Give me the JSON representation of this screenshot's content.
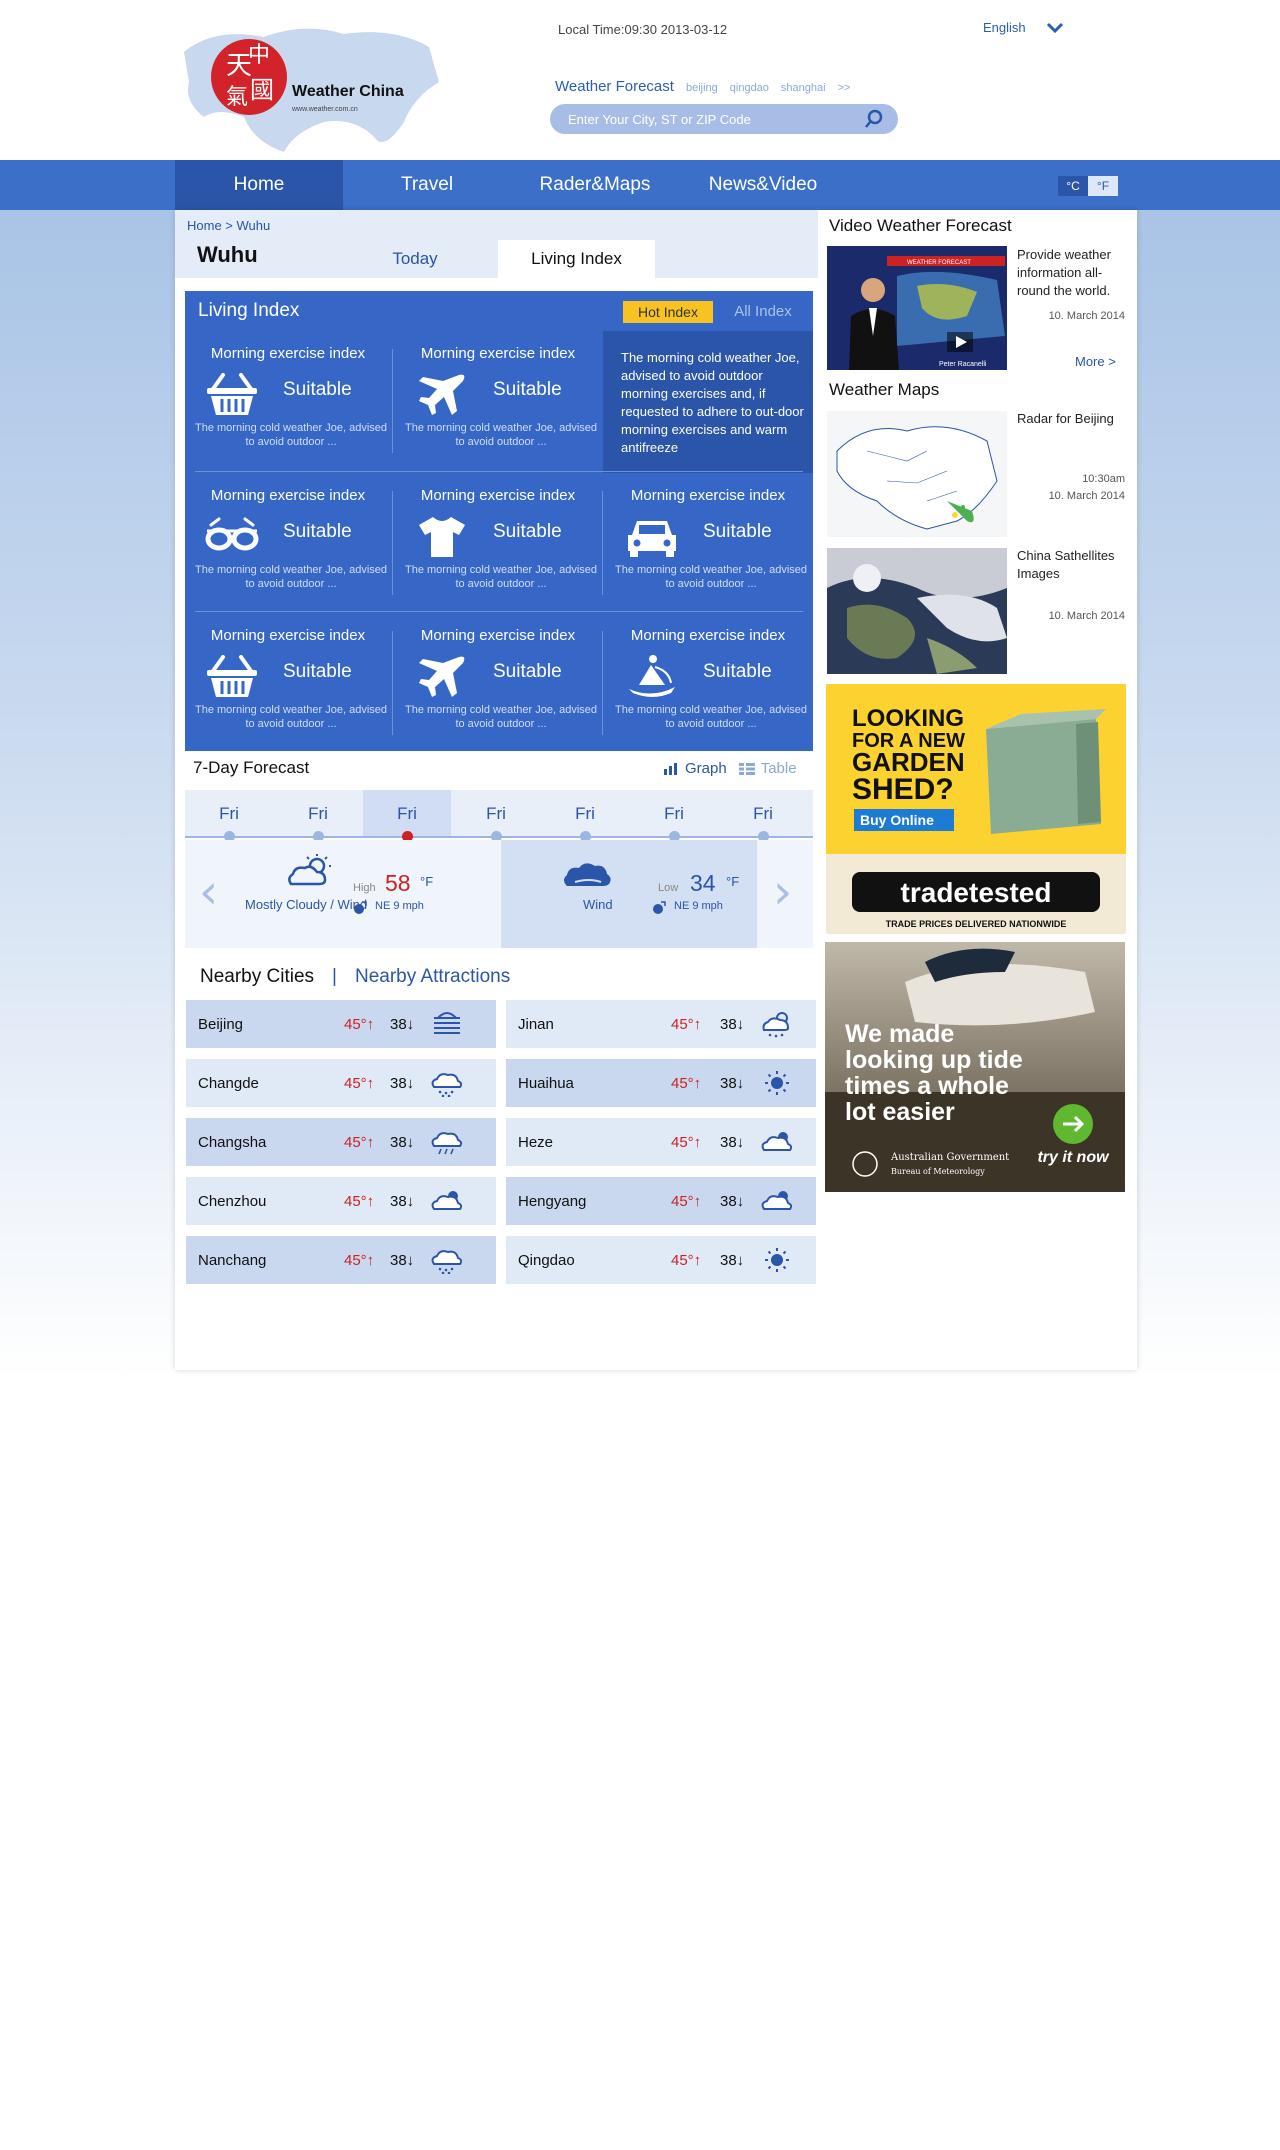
{
  "header": {
    "logo_text": "Weather China",
    "logo_url_text": "www.weather.com.cn",
    "local_time": "Local Time:09:30  2013-03-12",
    "language": "English",
    "forecast_label": "Weather Forecast",
    "quick_cities": [
      "beijing",
      "qingdao",
      "shanghai",
      ">>"
    ],
    "search_placeholder": "Enter Your City, ST or ZIP Code"
  },
  "nav": {
    "items": [
      "Home",
      "Travel",
      "Rader&Maps",
      "News&Video"
    ],
    "active": "Home",
    "unit_c": "°C",
    "unit_f": "°F"
  },
  "location": {
    "breadcrumb": "Home > Wuhu",
    "city": "Wuhu",
    "tabs": [
      "Today",
      "Living Index"
    ],
    "active_tab": "Living Index"
  },
  "living_index": {
    "title": "Living Index",
    "hot_label": "Hot Index",
    "all_label": "All Index",
    "feature_text": "The morning cold weather Joe, advised to avoid outdoor morning exercises and, if requested to adhere to out-door morning exercises and warm antifreeze",
    "items": [
      {
        "title": "Morning exercise index",
        "status": "Suitable",
        "desc": "The morning cold weather Joe, advised to avoid outdoor ...",
        "icon": "basket-icon"
      },
      {
        "title": "Morning exercise index",
        "status": "Suitable",
        "desc": "The morning cold weather Joe, advised to avoid outdoor ...",
        "icon": "airplane-icon"
      },
      {
        "title": "Morning exercise index",
        "status": "Suitable",
        "desc": "The morning cold weather Joe, advised to avoid outdoor ...",
        "icon": "sunglasses-icon"
      },
      {
        "title": "Morning exercise index",
        "status": "Suitable",
        "desc": "The morning cold weather Joe, advised to avoid outdoor ...",
        "icon": "tshirt-icon"
      },
      {
        "title": "Morning exercise index",
        "status": "Suitable",
        "desc": "The morning cold weather Joe, advised to avoid outdoor ...",
        "icon": "car-icon"
      },
      {
        "title": "Morning exercise index",
        "status": "Suitable",
        "desc": "The morning cold weather Joe, advised to avoid outdoor ...",
        "icon": "basket-icon"
      },
      {
        "title": "Morning exercise index",
        "status": "Suitable",
        "desc": "The morning cold weather Joe, advised to avoid outdoor ...",
        "icon": "airplane-icon"
      },
      {
        "title": "Morning exercise index",
        "status": "Suitable",
        "desc": "The morning cold weather Joe, advised to avoid outdoor ...",
        "icon": "sailing-icon"
      }
    ]
  },
  "forecast": {
    "title": "7-Day Forecast",
    "graph_label": "Graph",
    "table_label": "Table",
    "days": [
      "Fri",
      "Fri",
      "Fri",
      "Fri",
      "Fri",
      "Fri",
      "Fri"
    ],
    "selected_day": 2,
    "day_panel": {
      "condition": "Mostly Cloudy / Wind",
      "label": "High",
      "temp": "58",
      "unit": "°F",
      "wind": "NE  9 mph"
    },
    "night_panel": {
      "condition": "Wind",
      "label": "Low",
      "temp": "34",
      "unit": "°F",
      "wind": "NE  9 mph"
    }
  },
  "nearby": {
    "tab_cities": "Nearby Cities",
    "tab_attractions": "Nearby Attractions",
    "cities": [
      {
        "name": "Beijing",
        "high": "45°↑",
        "low": "38↓",
        "icon": "fog-icon"
      },
      {
        "name": "Jinan",
        "high": "45°↑",
        "low": "38↓",
        "icon": "cloud-snow-sun-icon"
      },
      {
        "name": "Changde",
        "high": "45°↑",
        "low": "38↓",
        "icon": "cloud-snow-icon"
      },
      {
        "name": "Huaihua",
        "high": "45°↑",
        "low": "38↓",
        "icon": "sun-icon"
      },
      {
        "name": "Changsha",
        "high": "45°↑",
        "low": "38↓",
        "icon": "cloud-rain-icon"
      },
      {
        "name": "Heze",
        "high": "45°↑",
        "low": "38↓",
        "icon": "partly-cloudy-icon"
      },
      {
        "name": "Chenzhou",
        "high": "45°↑",
        "low": "38↓",
        "icon": "partly-cloudy-icon"
      },
      {
        "name": "Hengyang",
        "high": "45°↑",
        "low": "38↓",
        "icon": "partly-cloudy-icon"
      },
      {
        "name": "Nanchang",
        "high": "45°↑",
        "low": "38↓",
        "icon": "cloud-snow-icon"
      },
      {
        "name": "Qingdao",
        "high": "45°↑",
        "low": "38↓",
        "icon": "sun-icon"
      }
    ]
  },
  "sidebar": {
    "video_title": "Video Weather Forecast",
    "video_desc": "Provide weather information all-round the world.",
    "video_date": "10. March 2014",
    "video_banner": "WEATHER FORECAST",
    "video_presenter": "Peter Racanelli",
    "more": "More >",
    "maps_title": "Weather Maps",
    "maps": [
      {
        "title": "Radar for Beijing",
        "time": "10:30am",
        "date": "10. March 2014"
      },
      {
        "title": "China Sathellites Images",
        "date": "10. March 2014"
      }
    ]
  },
  "ads": {
    "shed": {
      "line1": "LOOKING",
      "line2": "FOR A NEW",
      "line3": "GARDEN",
      "line4": "SHED?",
      "button": "Buy Online",
      "brand": "tradetested",
      "tagline": "TRADE PRICES DELIVERED NATIONWIDE"
    },
    "bom": {
      "line1": "We made",
      "line2": "looking up tide",
      "line3": "times a whole",
      "line4": "lot easier",
      "cta": "try it now",
      "org1": "Australian Government",
      "org2": "Bureau of Meteorology"
    }
  },
  "colors": {
    "primary": "#3767c6",
    "nav_active": "#2a55a8",
    "accent_yellow": "#f6c323",
    "high_temp": "#cc2222"
  }
}
